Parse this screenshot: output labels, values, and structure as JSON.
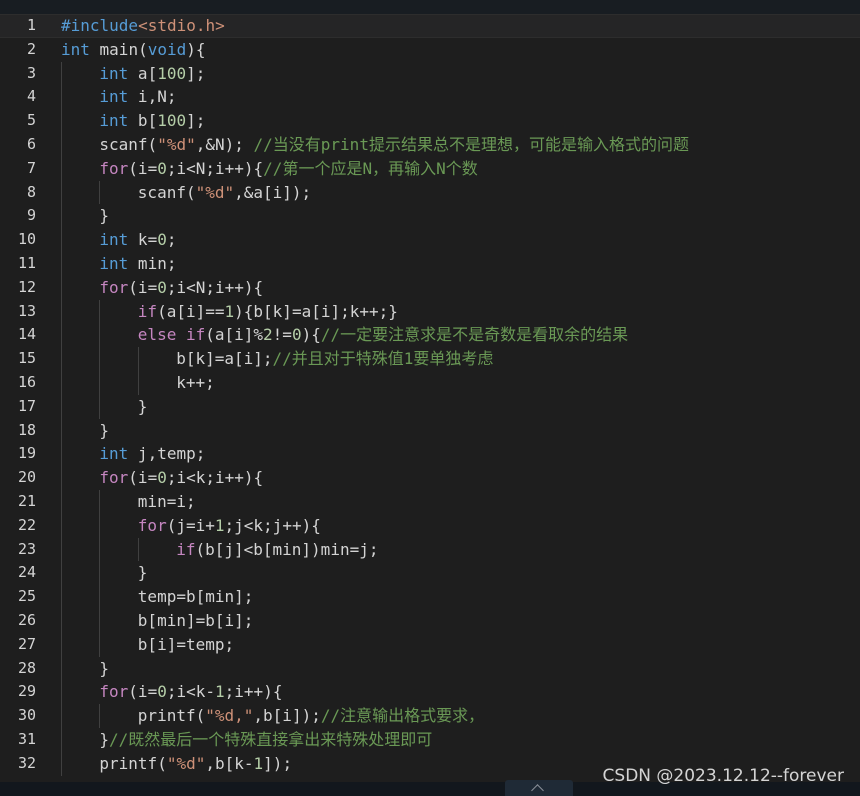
{
  "editor": {
    "language": "c",
    "active_line": 1,
    "lines": [
      {
        "n": "1",
        "indent": 0,
        "tokens": [
          [
            "pp",
            "#include"
          ],
          [
            "inc",
            "<stdio.h>"
          ]
        ]
      },
      {
        "n": "2",
        "indent": 0,
        "tokens": [
          [
            "kw",
            "int"
          ],
          [
            "plain",
            " main("
          ],
          [
            "kw",
            "void"
          ],
          [
            "plain",
            "){"
          ]
        ]
      },
      {
        "n": "3",
        "indent": 1,
        "tokens": [
          [
            "kw",
            "int"
          ],
          [
            "plain",
            " a["
          ],
          [
            "num",
            "100"
          ],
          [
            "plain",
            "];"
          ]
        ]
      },
      {
        "n": "4",
        "indent": 1,
        "tokens": [
          [
            "kw",
            "int"
          ],
          [
            "plain",
            " i,N;"
          ]
        ]
      },
      {
        "n": "5",
        "indent": 1,
        "tokens": [
          [
            "kw",
            "int"
          ],
          [
            "plain",
            " b["
          ],
          [
            "num",
            "100"
          ],
          [
            "plain",
            "];"
          ]
        ]
      },
      {
        "n": "6",
        "indent": 1,
        "tokens": [
          [
            "plain",
            "scanf("
          ],
          [
            "str",
            "\"%d\""
          ],
          [
            "plain",
            ",&N); "
          ],
          [
            "cmt",
            "//当没有print提示结果总不是理想，可能是输入格式的问题"
          ]
        ]
      },
      {
        "n": "7",
        "indent": 1,
        "tokens": [
          [
            "ctl",
            "for"
          ],
          [
            "plain",
            "(i="
          ],
          [
            "num",
            "0"
          ],
          [
            "plain",
            ";i<N;i++){"
          ],
          [
            "cmt",
            "//第一个应是N，再输入N个数"
          ]
        ]
      },
      {
        "n": "8",
        "indent": 2,
        "tokens": [
          [
            "plain",
            "scanf("
          ],
          [
            "str",
            "\"%d\""
          ],
          [
            "plain",
            ",&a[i]);"
          ]
        ]
      },
      {
        "n": "9",
        "indent": 1,
        "tokens": [
          [
            "plain",
            "}"
          ]
        ]
      },
      {
        "n": "10",
        "indent": 1,
        "tokens": [
          [
            "kw",
            "int"
          ],
          [
            "plain",
            " k="
          ],
          [
            "num",
            "0"
          ],
          [
            "plain",
            ";"
          ]
        ]
      },
      {
        "n": "11",
        "indent": 1,
        "tokens": [
          [
            "kw",
            "int"
          ],
          [
            "plain",
            " min;"
          ]
        ]
      },
      {
        "n": "12",
        "indent": 1,
        "tokens": [
          [
            "ctl",
            "for"
          ],
          [
            "plain",
            "(i="
          ],
          [
            "num",
            "0"
          ],
          [
            "plain",
            ";i<N;i++){"
          ]
        ]
      },
      {
        "n": "13",
        "indent": 2,
        "tokens": [
          [
            "ctl",
            "if"
          ],
          [
            "plain",
            "(a[i]=="
          ],
          [
            "num",
            "1"
          ],
          [
            "plain",
            "){b[k]=a[i];k++;}"
          ]
        ]
      },
      {
        "n": "14",
        "indent": 2,
        "tokens": [
          [
            "ctl",
            "else"
          ],
          [
            "plain",
            " "
          ],
          [
            "ctl",
            "if"
          ],
          [
            "plain",
            "(a[i]%"
          ],
          [
            "num",
            "2"
          ],
          [
            "plain",
            "!="
          ],
          [
            "num",
            "0"
          ],
          [
            "plain",
            "){"
          ],
          [
            "cmt",
            "//一定要注意求是不是奇数是看取余的结果"
          ]
        ]
      },
      {
        "n": "15",
        "indent": 3,
        "tokens": [
          [
            "plain",
            "b[k]=a[i];"
          ],
          [
            "cmt",
            "//并且对于特殊值1要单独考虑"
          ]
        ]
      },
      {
        "n": "16",
        "indent": 3,
        "tokens": [
          [
            "plain",
            "k++;"
          ]
        ]
      },
      {
        "n": "17",
        "indent": 2,
        "tokens": [
          [
            "plain",
            "}"
          ]
        ]
      },
      {
        "n": "18",
        "indent": 1,
        "tokens": [
          [
            "plain",
            "}"
          ]
        ]
      },
      {
        "n": "19",
        "indent": 1,
        "tokens": [
          [
            "kw",
            "int"
          ],
          [
            "plain",
            " j,temp;"
          ]
        ]
      },
      {
        "n": "20",
        "indent": 1,
        "tokens": [
          [
            "ctl",
            "for"
          ],
          [
            "plain",
            "(i="
          ],
          [
            "num",
            "0"
          ],
          [
            "plain",
            ";i<k;i++){"
          ]
        ]
      },
      {
        "n": "21",
        "indent": 2,
        "tokens": [
          [
            "plain",
            "min=i;"
          ]
        ]
      },
      {
        "n": "22",
        "indent": 2,
        "tokens": [
          [
            "ctl",
            "for"
          ],
          [
            "plain",
            "(j=i+"
          ],
          [
            "num",
            "1"
          ],
          [
            "plain",
            ";j<k;j++){"
          ]
        ]
      },
      {
        "n": "23",
        "indent": 3,
        "tokens": [
          [
            "ctl",
            "if"
          ],
          [
            "plain",
            "(b[j]<b[min])min=j;"
          ]
        ]
      },
      {
        "n": "24",
        "indent": 2,
        "tokens": [
          [
            "plain",
            "}"
          ]
        ]
      },
      {
        "n": "25",
        "indent": 2,
        "tokens": [
          [
            "plain",
            "temp=b[min];"
          ]
        ]
      },
      {
        "n": "26",
        "indent": 2,
        "tokens": [
          [
            "plain",
            "b[min]=b[i];"
          ]
        ]
      },
      {
        "n": "27",
        "indent": 2,
        "tokens": [
          [
            "plain",
            "b[i]=temp;"
          ]
        ]
      },
      {
        "n": "28",
        "indent": 1,
        "tokens": [
          [
            "plain",
            "}"
          ]
        ]
      },
      {
        "n": "29",
        "indent": 1,
        "tokens": [
          [
            "ctl",
            "for"
          ],
          [
            "plain",
            "(i="
          ],
          [
            "num",
            "0"
          ],
          [
            "plain",
            ";i<k-"
          ],
          [
            "num",
            "1"
          ],
          [
            "plain",
            ";i++){"
          ]
        ]
      },
      {
        "n": "30",
        "indent": 2,
        "tokens": [
          [
            "plain",
            "printf("
          ],
          [
            "str",
            "\"%d,\""
          ],
          [
            "plain",
            ",b[i]);"
          ],
          [
            "cmt",
            "//注意输出格式要求，"
          ]
        ]
      },
      {
        "n": "31",
        "indent": 1,
        "tokens": [
          [
            "plain",
            "}"
          ],
          [
            "cmt",
            "//既然最后一个特殊直接拿出来特殊处理即可"
          ]
        ]
      },
      {
        "n": "32",
        "indent": 1,
        "tokens": [
          [
            "plain",
            "printf("
          ],
          [
            "str",
            "\"%d\""
          ],
          [
            "plain",
            ",b[k-"
          ],
          [
            "num",
            "1"
          ],
          [
            "plain",
            "]);"
          ]
        ]
      }
    ]
  },
  "watermark": {
    "text": "CSDN @2023.12.12--forever"
  },
  "colors": {
    "background": "#1e1e1e",
    "keyword": "#569cd6",
    "control": "#c586c0",
    "string": "#ce9178",
    "number": "#b5cea8",
    "comment": "#6a9955",
    "text": "#d4d4d4"
  }
}
